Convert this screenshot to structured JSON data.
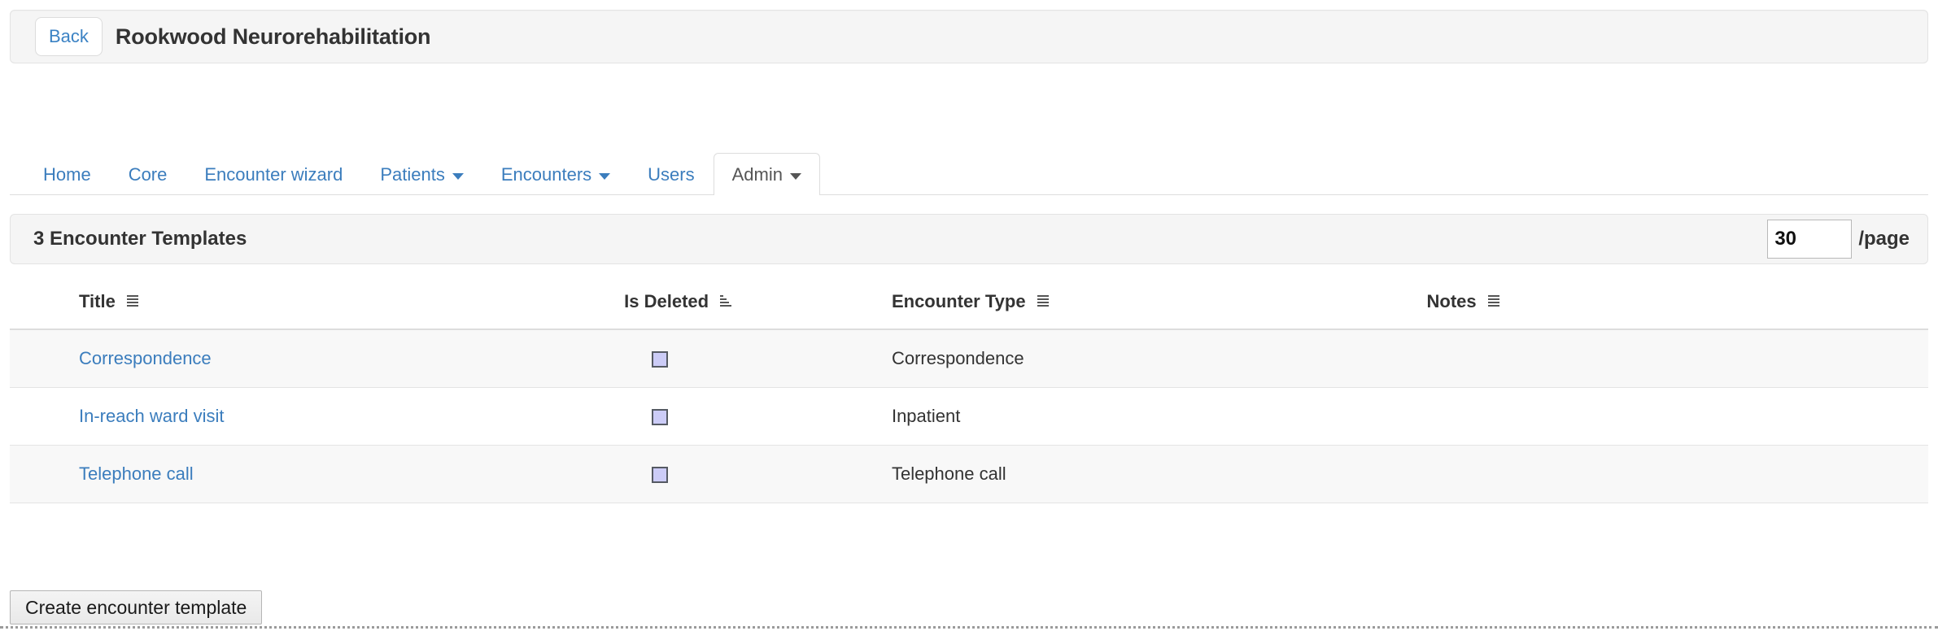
{
  "header": {
    "back_label": "Back",
    "title": "Rookwood Neurorehabilitation"
  },
  "nav": {
    "tabs": [
      {
        "label": "Home",
        "active": false,
        "caret": false
      },
      {
        "label": "Core",
        "active": false,
        "caret": false
      },
      {
        "label": "Encounter wizard",
        "active": false,
        "caret": false
      },
      {
        "label": "Patients",
        "active": false,
        "caret": true
      },
      {
        "label": "Encounters",
        "active": false,
        "caret": true
      },
      {
        "label": "Users",
        "active": false,
        "caret": false
      },
      {
        "label": "Admin",
        "active": true,
        "caret": true
      }
    ]
  },
  "results_bar": {
    "count_label": "3 Encounter Templates",
    "per_page_value": "30",
    "per_page_placeholder": "",
    "per_page_label": "/page"
  },
  "table": {
    "columns": [
      {
        "label": "Title",
        "sort_icon": "sort-none-icon"
      },
      {
        "label": "Is Deleted",
        "sort_icon": "sort-asc-icon"
      },
      {
        "label": "Encounter Type",
        "sort_icon": "sort-none-icon"
      },
      {
        "label": "Notes",
        "sort_icon": "sort-none-icon"
      }
    ],
    "rows": [
      {
        "title": "Correspondence",
        "is_deleted": false,
        "encounter_type": "Correspondence",
        "notes": ""
      },
      {
        "title": "In-reach ward visit",
        "is_deleted": false,
        "encounter_type": "Inpatient",
        "notes": ""
      },
      {
        "title": "Telephone call",
        "is_deleted": false,
        "encounter_type": "Telephone call",
        "notes": ""
      }
    ]
  },
  "actions": {
    "create_label": "Create encounter template"
  },
  "colors": {
    "link": "#3b7dbd",
    "panel_bg": "#f5f5f5",
    "panel_border": "#e3e3e3",
    "text": "#333333",
    "checkbox_fill": "#ccccf7",
    "row_stripe": "#f8f8f8"
  }
}
